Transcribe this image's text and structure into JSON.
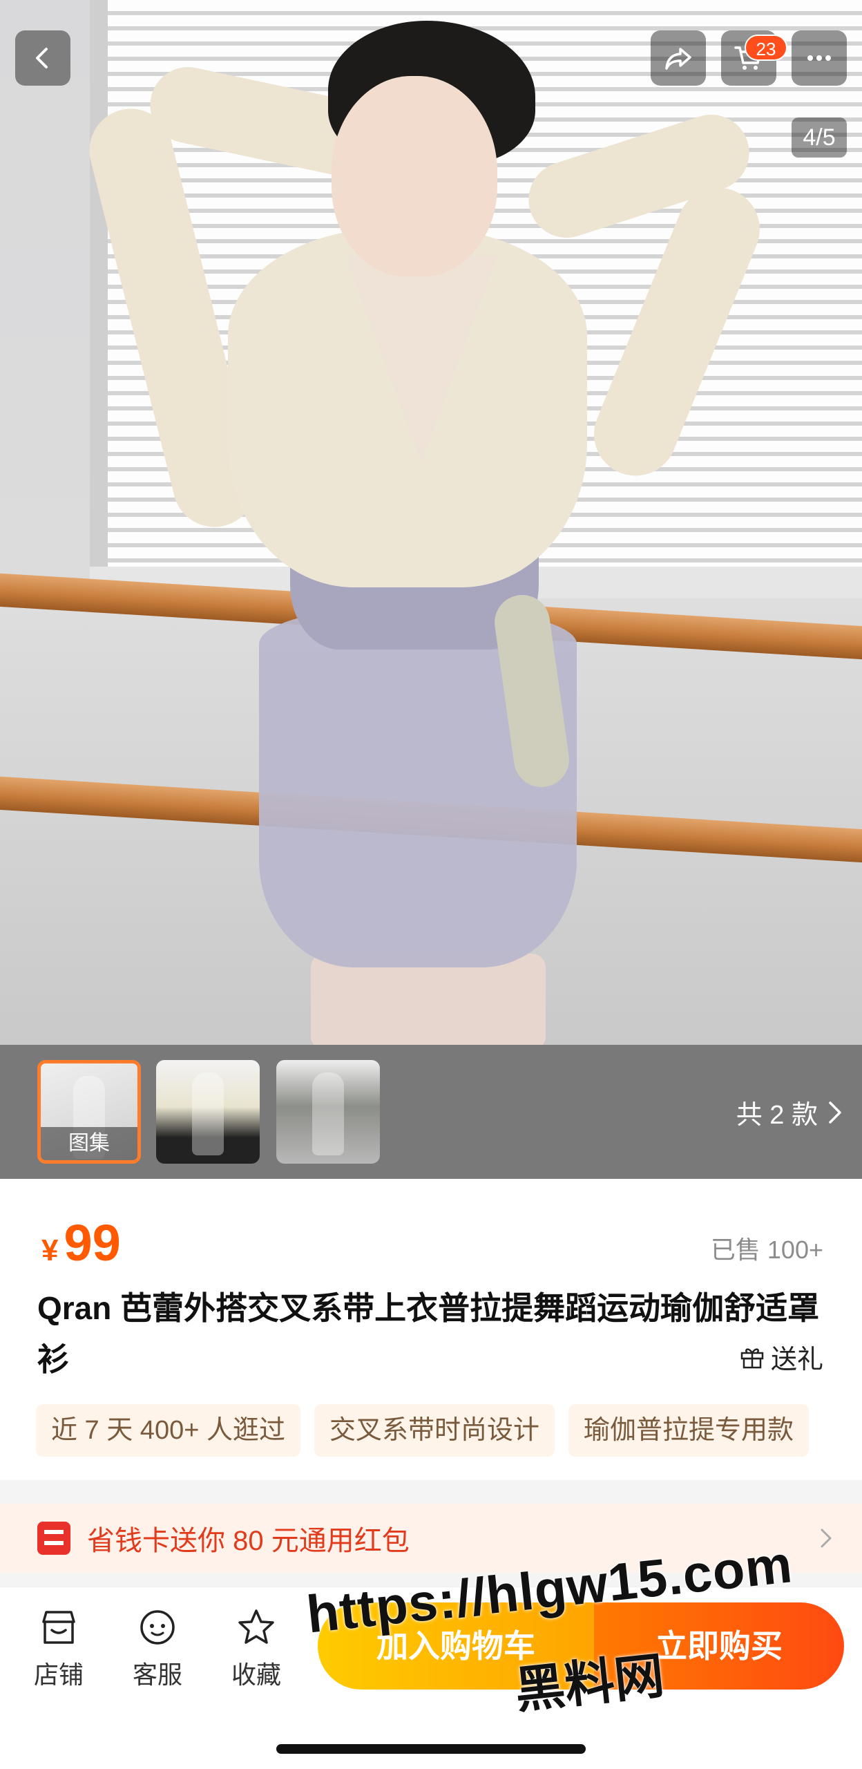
{
  "gallery": {
    "page_indicator": "4/5",
    "cart_count": "23",
    "thumbnails": [
      {
        "label": "图集"
      },
      {
        "label": ""
      },
      {
        "label": ""
      }
    ],
    "variants_label": "共 2 款"
  },
  "product": {
    "currency": "¥",
    "price": "99",
    "sold": "已售 100+",
    "title": "Qran 芭蕾外搭交叉系带上衣普拉提舞蹈运动瑜伽舒适罩衫",
    "gift_label": "送礼",
    "tags": [
      "近 7 天 400+ 人逛过",
      "交叉系带时尚设计",
      "瑜伽普拉提专用款"
    ]
  },
  "promo": {
    "text": "省钱卡送你 80 元通用红包"
  },
  "bottom_bar": {
    "shop_label": "店铺",
    "service_label": "客服",
    "favorite_label": "收藏",
    "cart_button": "加入购物车",
    "buy_button": "立即购买"
  },
  "watermark": {
    "url": "https://hlgw15.com",
    "site": "黑料网"
  },
  "colors": {
    "accent_orange": "#ff5a00",
    "buy_gradient": "#ff4a12",
    "cart_gradient": "#ffa400",
    "badge": "#ff4d1c"
  }
}
